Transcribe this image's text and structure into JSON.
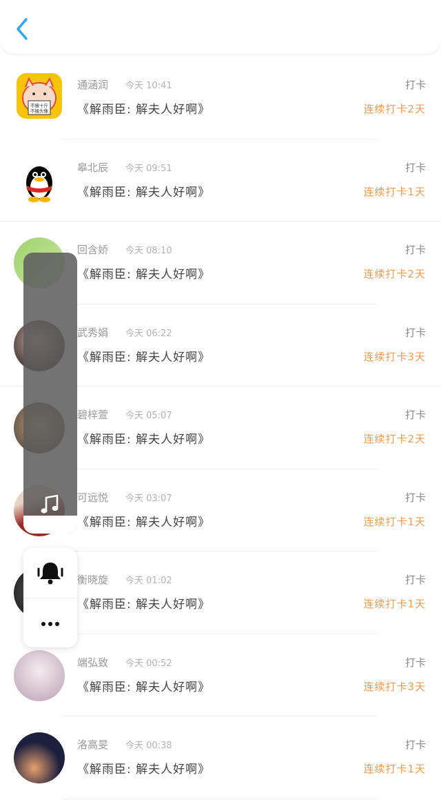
{
  "header": {
    "back_icon": "chevron-left-icon",
    "accent": "#2aa7f3"
  },
  "records": [
    {
      "name": "通涵润",
      "time": "今天 10:41",
      "title": "《解雨臣:  解夫人好啊》",
      "action": "打卡",
      "streak": "连续打卡2天",
      "avatar_colors": [
        "#f6c40b",
        "#fbd9c9"
      ],
      "avatar_text": [
        "不瘦十斤",
        "不换头像"
      ]
    },
    {
      "name": "皋北辰",
      "time": "今天 09:51",
      "title": "《解雨臣:  解夫人好啊》",
      "action": "打卡",
      "streak": "连续打卡1天",
      "avatar_colors": [
        "#000000",
        "#d92a1e"
      ]
    },
    {
      "name": "回含娇",
      "time": "今天 08:10",
      "title": "《解雨臣:  解夫人好啊》",
      "action": "打卡",
      "streak": "连续打卡2天",
      "avatar_colors": [
        "#9fd36a",
        "#c9e5a8"
      ]
    },
    {
      "name": "武秀娟",
      "time": "今天 06:22",
      "title": "《解雨臣:  解夫人好啊》",
      "action": "打卡",
      "streak": "连续打卡3天",
      "avatar_colors": [
        "#4b3b3a",
        "#c9a8a0"
      ]
    },
    {
      "name": "碧梓萱",
      "time": "今天 05:07",
      "title": "《解雨臣:  解夫人好啊》",
      "action": "打卡",
      "streak": "连续打卡2天",
      "avatar_colors": [
        "#6b5c4a",
        "#c2a27a"
      ]
    },
    {
      "name": "可远悦",
      "time": "今天 03:07",
      "title": "《解雨臣:  解夫人好啊》",
      "action": "打卡",
      "streak": "连续打卡1天",
      "avatar_colors": [
        "#9a2b24",
        "#e7d3c6"
      ]
    },
    {
      "name": "衡晓旋",
      "time": "今天 01:02",
      "title": "《解雨臣:  解夫人好啊》",
      "action": "打卡",
      "streak": "连续打卡1天",
      "avatar_colors": [
        "#2b2b2b",
        "#6c6c6c"
      ]
    },
    {
      "name": "端弘致",
      "time": "今天 00:52",
      "title": "《解雨臣:  解夫人好啊》",
      "action": "打卡",
      "streak": "连续打卡3天",
      "avatar_colors": [
        "#e9dbe4",
        "#c9b3c4"
      ]
    },
    {
      "name": "洛高旻",
      "time": "今天 00:38",
      "title": "《解雨臣:  解夫人好啊》",
      "action": "打卡",
      "streak": "连续打卡1天",
      "avatar_colors": [
        "#1c1f3e",
        "#e6a06e"
      ]
    }
  ],
  "floating_panel": {
    "music_icon": "music-note-icon"
  },
  "side_actions": {
    "bell_icon": "bell-icon",
    "more_icon": "more-dots-icon"
  }
}
